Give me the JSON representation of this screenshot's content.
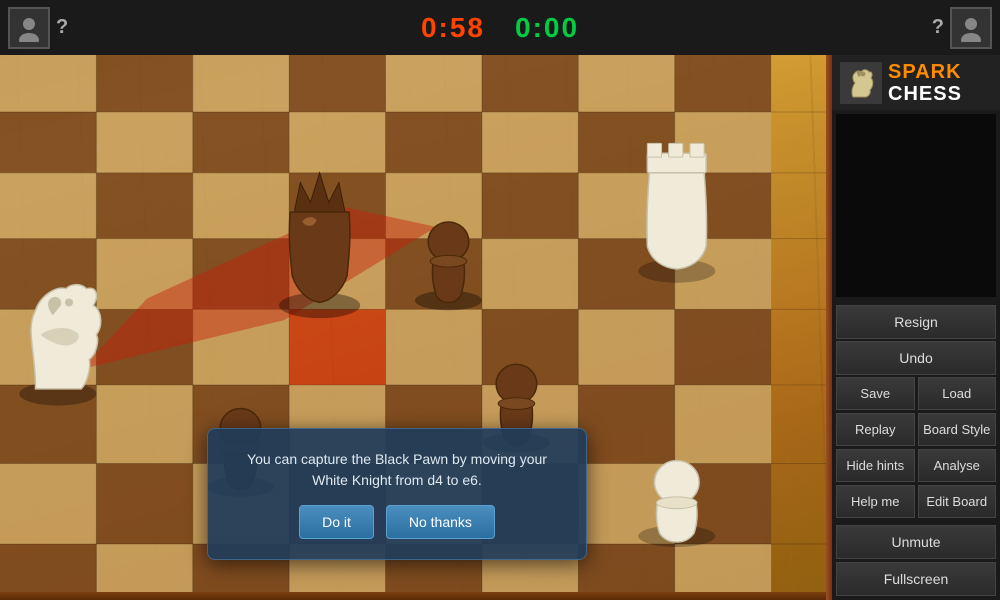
{
  "header": {
    "player_left": {
      "avatar_label": "player-avatar-left",
      "question": "?"
    },
    "timer_left": "0:58",
    "timer_right": "0:00",
    "player_right": {
      "avatar_label": "player-avatar-right",
      "question": "?"
    }
  },
  "brand": {
    "spark": "SPARK",
    "chess": "CHESS"
  },
  "sidebar": {
    "resign": "Resign",
    "undo": "Undo",
    "save": "Save",
    "load": "Load",
    "replay": "Replay",
    "board_style": "Board Style",
    "hide_hints": "Hide hints",
    "analyse": "Analyse",
    "help_me": "Help me",
    "edit_board": "Edit Board",
    "unmute": "Unmute",
    "fullscreen": "Fullscreen"
  },
  "dialog": {
    "message": "You can capture the Black Pawn by moving your White Knight from d4 to e6.",
    "btn_doit": "Do it",
    "btn_nothanks": "No thanks"
  }
}
